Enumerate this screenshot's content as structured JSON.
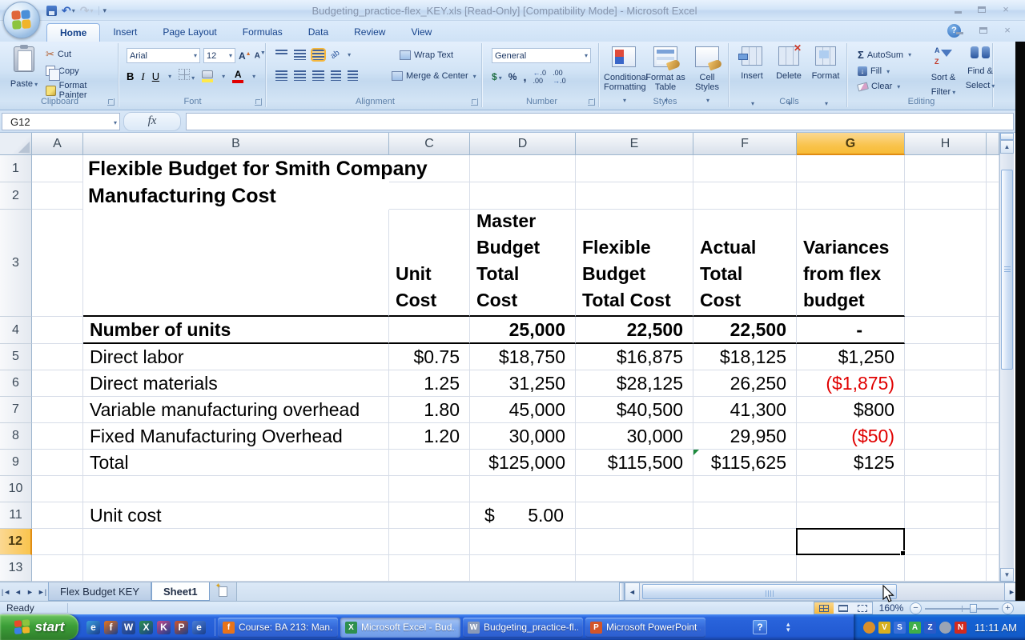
{
  "title_bar": {
    "title": "Budgeting_practice-flex_KEY.xls  [Read-Only]  [Compatibility Mode] - Microsoft Excel"
  },
  "ribbon": {
    "tabs": [
      {
        "label": "Home",
        "active": true
      },
      {
        "label": "Insert"
      },
      {
        "label": "Page Layout"
      },
      {
        "label": "Formulas"
      },
      {
        "label": "Data"
      },
      {
        "label": "Review"
      },
      {
        "label": "View"
      }
    ],
    "clipboard": {
      "label": "Clipboard",
      "paste": "Paste",
      "cut": "Cut",
      "copy": "Copy",
      "format_painter": "Format Painter"
    },
    "font": {
      "label": "Font",
      "name": "Arial",
      "size": "12",
      "bold": "B",
      "italic": "I",
      "underline": "U"
    },
    "alignment": {
      "label": "Alignment",
      "wrap_text": "Wrap Text",
      "merge_center": "Merge & Center"
    },
    "number": {
      "label": "Number",
      "format": "General",
      "currency": "$",
      "percent": "%",
      "comma": ","
    },
    "styles": {
      "label": "Styles",
      "items": [
        "Conditional Formatting",
        "Format as Table",
        "Cell Styles"
      ]
    },
    "cells": {
      "label": "Cells",
      "items": [
        "Insert",
        "Delete",
        "Format"
      ]
    },
    "editing": {
      "label": "Editing",
      "sigma": "Σ",
      "autosum": "AutoSum",
      "fill": "Fill",
      "clear": "Clear",
      "sort_filter": "Sort & Filter",
      "find_select": "Find & Select"
    }
  },
  "formula_bar": {
    "name_box": "G12",
    "fx": "fx",
    "formula": ""
  },
  "grid": {
    "columns": [
      "A",
      "B",
      "C",
      "D",
      "E",
      "F",
      "G",
      "H"
    ],
    "selected_column": "G",
    "selected_row": "12",
    "selected_cell": "G12"
  },
  "sheet": {
    "rows": [
      {
        "n": "1",
        "cells": [
          {
            "col": "B",
            "kind": "title",
            "text": "Flexible Budget for Smith Company"
          }
        ]
      },
      {
        "n": "2",
        "cells": [
          {
            "col": "B",
            "kind": "title",
            "text": "Manufacturing Cost"
          }
        ]
      },
      {
        "n": "3",
        "bb": true,
        "cells": [
          {
            "col": "C",
            "kind": "head",
            "text": "Unit\nCost"
          },
          {
            "col": "D",
            "kind": "head",
            "text": "Master\nBudget\nTotal\nCost"
          },
          {
            "col": "E",
            "kind": "head",
            "text": "Flexible\nBudget\nTotal Cost"
          },
          {
            "col": "F",
            "kind": "head",
            "text": "Actual\nTotal\nCost"
          },
          {
            "col": "G",
            "kind": "head",
            "text": "Variances\nfrom flex\nbudget"
          }
        ]
      },
      {
        "n": "4",
        "bb": true,
        "cells": [
          {
            "col": "B",
            "kind": "label labelb",
            "text": "Number of units"
          },
          {
            "col": "D",
            "kind": "numb",
            "text": "25,000"
          },
          {
            "col": "E",
            "kind": "numb",
            "text": "22,500"
          },
          {
            "col": "F",
            "kind": "numb",
            "text": "22,500"
          },
          {
            "col": "G",
            "kind": "numb dash",
            "text": "-"
          }
        ]
      },
      {
        "n": "5",
        "cells": [
          {
            "col": "B",
            "kind": "label",
            "text": "Direct labor"
          },
          {
            "col": "C",
            "kind": "num",
            "text": "$0.75"
          },
          {
            "col": "D",
            "kind": "num",
            "text": "$18,750"
          },
          {
            "col": "E",
            "kind": "num",
            "text": "$16,875"
          },
          {
            "col": "F",
            "kind": "num",
            "text": "$18,125"
          },
          {
            "col": "G",
            "kind": "num",
            "text": "$1,250"
          }
        ]
      },
      {
        "n": "6",
        "cells": [
          {
            "col": "B",
            "kind": "label",
            "text": "Direct materials"
          },
          {
            "col": "C",
            "kind": "num",
            "text": "1.25"
          },
          {
            "col": "D",
            "kind": "num",
            "text": "31,250"
          },
          {
            "col": "E",
            "kind": "num",
            "text": "$28,125"
          },
          {
            "col": "F",
            "kind": "num",
            "text": "26,250"
          },
          {
            "col": "G",
            "kind": "num neg",
            "text": "($1,875)"
          }
        ]
      },
      {
        "n": "7",
        "cells": [
          {
            "col": "B",
            "kind": "label",
            "text": "Variable manufacturing overhead"
          },
          {
            "col": "C",
            "kind": "num",
            "text": "1.80"
          },
          {
            "col": "D",
            "kind": "num",
            "text": "45,000"
          },
          {
            "col": "E",
            "kind": "num",
            "text": "$40,500"
          },
          {
            "col": "F",
            "kind": "num",
            "text": "41,300"
          },
          {
            "col": "G",
            "kind": "num",
            "text": "$800"
          }
        ]
      },
      {
        "n": "8",
        "cells": [
          {
            "col": "B",
            "kind": "label",
            "text": "Fixed Manufacturing Overhead"
          },
          {
            "col": "C",
            "kind": "num",
            "text": "1.20"
          },
          {
            "col": "D",
            "kind": "num",
            "text": "30,000"
          },
          {
            "col": "E",
            "kind": "num",
            "text": "30,000"
          },
          {
            "col": "F",
            "kind": "num",
            "text": "29,950"
          },
          {
            "col": "G",
            "kind": "num neg",
            "text": "($50)"
          }
        ]
      },
      {
        "n": "9",
        "cells": [
          {
            "col": "B",
            "kind": "label",
            "text": "Total"
          },
          {
            "col": "D",
            "kind": "num",
            "text": "$125,000"
          },
          {
            "col": "E",
            "kind": "num",
            "text": "$115,500"
          },
          {
            "col": "F",
            "kind": "num",
            "text": "$115,625",
            "indicator": true
          },
          {
            "col": "G",
            "kind": "num",
            "text": "$125"
          }
        ]
      },
      {
        "n": "10",
        "cells": []
      },
      {
        "n": "11",
        "cells": [
          {
            "col": "B",
            "kind": "label",
            "text": "Unit cost"
          },
          {
            "col": "D",
            "kind": "money",
            "sym": "$",
            "text": "5.00"
          }
        ]
      },
      {
        "n": "12",
        "cells": []
      },
      {
        "n": "13",
        "cells": []
      }
    ]
  },
  "sheet_tabs": {
    "tabs": [
      {
        "label": "Flex Budget KEY"
      },
      {
        "label": "Sheet1",
        "active": true
      }
    ]
  },
  "status_bar": {
    "mode": "Ready",
    "zoom_level": "160%"
  },
  "taskbar": {
    "start_label": "start",
    "quick_launch": [
      {
        "name": "internet-explorer-icon",
        "glyph": "e",
        "color": "#3a9ede"
      },
      {
        "name": "firefox-icon",
        "glyph": "f",
        "color": "#e8731a"
      },
      {
        "name": "word-icon",
        "glyph": "W",
        "color": "#3a5da8"
      },
      {
        "name": "excel-icon",
        "glyph": "X",
        "color": "#2e8f4e"
      },
      {
        "name": "pink-app-icon",
        "glyph": "K",
        "color": "#c84a88"
      },
      {
        "name": "powerpoint-icon",
        "glyph": "P",
        "color": "#d2552a"
      },
      {
        "name": "explorer-icon",
        "glyph": "e",
        "color": "#4a7fd8"
      }
    ],
    "buttons": [
      {
        "label": "Course: BA 213: Man...",
        "icon": "firefox",
        "color": "#e8731a",
        "glyph": "f",
        "active": false
      },
      {
        "label": "Microsoft Excel - Bud...",
        "icon": "excel",
        "color": "#2e8f4e",
        "glyph": "X",
        "active": true
      },
      {
        "label": "Budgeting_practice-fl...",
        "icon": "document",
        "color": "#8a9ab8",
        "glyph": "W",
        "active": false
      },
      {
        "label": "Microsoft PowerPoint ...",
        "icon": "powerpoint",
        "color": "#d2552a",
        "glyph": "P",
        "active": false
      }
    ],
    "help_glyph": "?",
    "tray_icons": [
      {
        "name": "tray-orange-icon",
        "glyph": "",
        "color": "#d98f2b",
        "round": true
      },
      {
        "name": "tray-shield-icon",
        "glyph": "V",
        "color": "#d8b020"
      },
      {
        "name": "tray-blue-icon",
        "glyph": "S",
        "color": "#3a6fd8"
      },
      {
        "name": "tray-green-icon",
        "glyph": "A",
        "color": "#3fae4a"
      },
      {
        "name": "tray-z-icon",
        "glyph": "Z",
        "color": "#2a5ac8"
      },
      {
        "name": "tray-gray-icon",
        "glyph": "",
        "color": "#9aa4b4",
        "round": true
      },
      {
        "name": "tray-n-icon",
        "glyph": "N",
        "color": "#d22a1e"
      }
    ],
    "clock": "11:11 AM"
  }
}
